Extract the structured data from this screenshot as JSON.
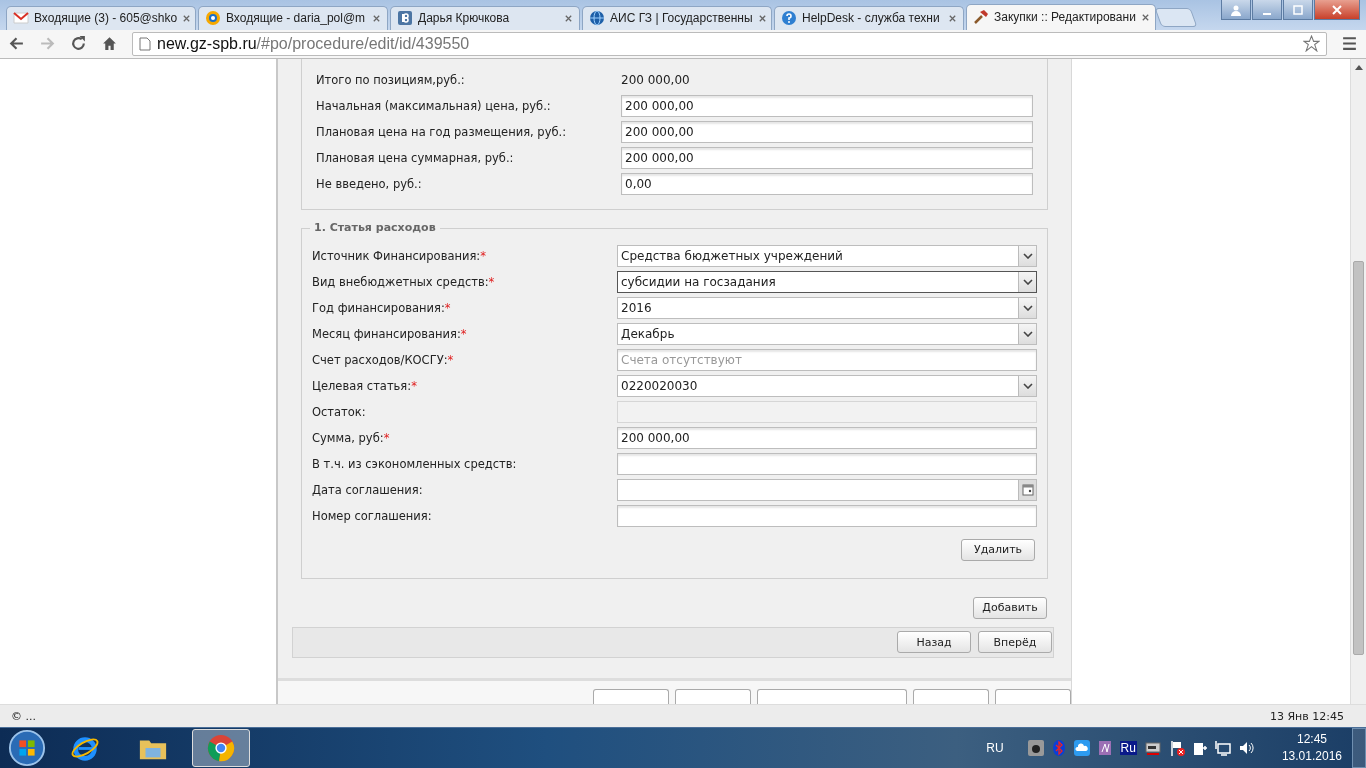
{
  "browser": {
    "tabs": [
      {
        "title": "Входящие (3) - 605@shko",
        "kind": "mail",
        "selected": false
      },
      {
        "title": "Входящие - daria_pol@m",
        "kind": "ring",
        "selected": false
      },
      {
        "title": "Дарья Крючкова",
        "kind": "vk",
        "selected": false
      },
      {
        "title": "АИС ГЗ | Государственны",
        "kind": "globe",
        "selected": false
      },
      {
        "title": "HelpDesk - служба техни",
        "kind": "help",
        "selected": false
      },
      {
        "title": "Закупки :: Редактировани",
        "kind": "tool",
        "selected": true
      }
    ],
    "address": {
      "host": "new.gz-spb.ru",
      "path": "/#po/procedure/edit/id/439550"
    }
  },
  "summary": [
    {
      "label": "Итого по позициям,руб.:",
      "value": "200 000,00",
      "kind": "text"
    },
    {
      "label": "Начальная (максимальная) цена, руб.:",
      "value": "200 000,00",
      "kind": "input"
    },
    {
      "label": "Плановая цена на год размещения, руб.:",
      "value": "200 000,00",
      "kind": "input"
    },
    {
      "label": "Плановая цена суммарная, руб.:",
      "value": "200 000,00",
      "kind": "input"
    },
    {
      "label": "Не введено, руб.:",
      "value": "0,00",
      "kind": "input"
    }
  ],
  "section": {
    "legend": "1. Статья расходов",
    "required_mark": "*",
    "fields": [
      {
        "label": "Источник Финансирования:",
        "required": true,
        "kind": "select",
        "value": "Средства бюджетных учреждений",
        "focused": false
      },
      {
        "label": "Вид внебюджетных средств:",
        "required": true,
        "kind": "select",
        "value": "субсидии на госзадания",
        "focused": true
      },
      {
        "label": "Год финансирования:",
        "required": true,
        "kind": "select",
        "value": "2016",
        "focused": false
      },
      {
        "label": "Месяц финансирования:",
        "required": true,
        "kind": "select",
        "value": "Декабрь",
        "focused": false
      },
      {
        "label": "Счет расходов/КОСГУ:",
        "required": true,
        "kind": "input",
        "placeholder": "Счета отсутствуют",
        "focused": false
      },
      {
        "label": "Целевая статья:",
        "required": true,
        "kind": "select",
        "value": "0220020030",
        "focused": false
      },
      {
        "label": "Остаток:",
        "required": false,
        "kind": "readonly",
        "focused": false
      },
      {
        "label": "Сумма, руб:",
        "required": true,
        "kind": "input",
        "value": "200 000,00",
        "focused": false
      },
      {
        "label": "В т.ч. из сэкономленных средств:",
        "required": false,
        "kind": "input",
        "focused": false
      },
      {
        "label": "Дата соглашения:",
        "required": false,
        "kind": "date",
        "focused": false
      },
      {
        "label": "Номер соглашения:",
        "required": false,
        "kind": "input",
        "focused": false
      }
    ],
    "delete_button": "Удалить"
  },
  "add_button": "Добавить",
  "nav_buttons": [
    "Назад",
    "Вперёд"
  ],
  "status_bar": {
    "left": "© ...",
    "right": "13 Янв 12:45"
  },
  "taskbar": {
    "apps": [
      {
        "kind": "ie",
        "selected": false
      },
      {
        "kind": "folder",
        "selected": false
      },
      {
        "kind": "chrome",
        "selected": true
      }
    ],
    "language": "RU",
    "tray_badge": "Ru",
    "time": "12:45",
    "date": "13.01.2016"
  }
}
